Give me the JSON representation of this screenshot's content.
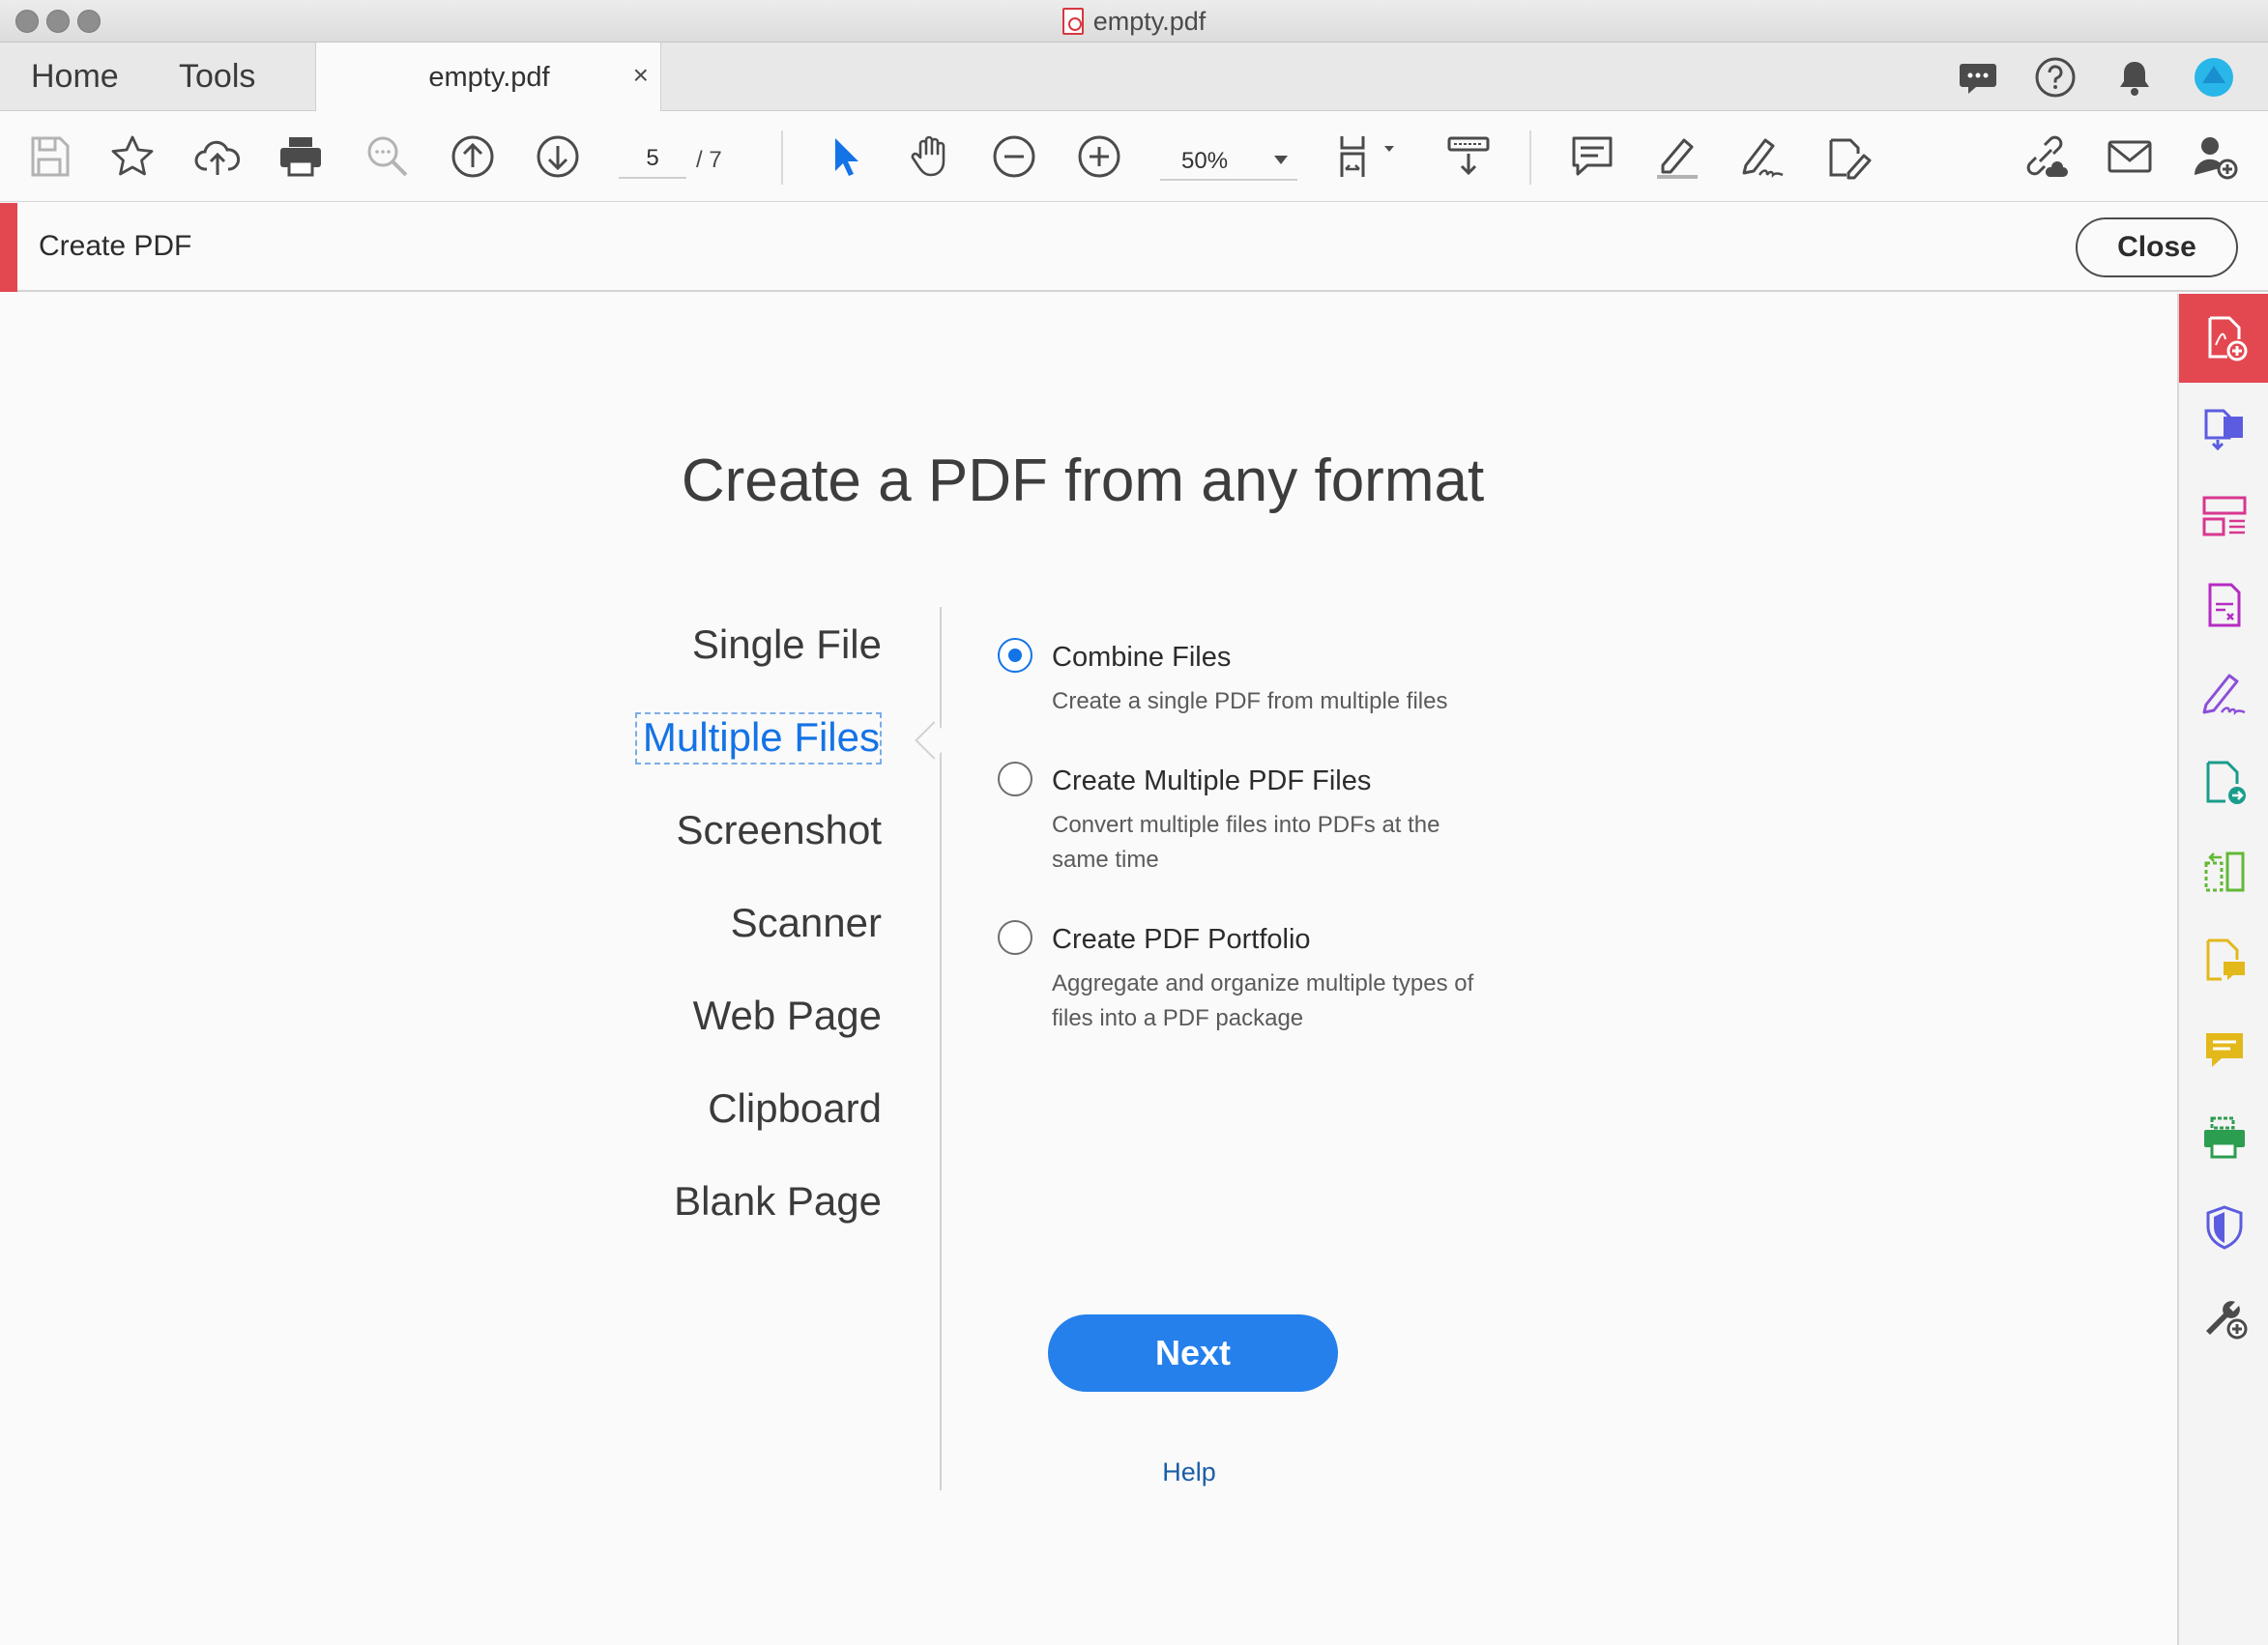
{
  "window": {
    "title": "empty.pdf"
  },
  "tabs": {
    "home": "Home",
    "tools": "Tools",
    "document": "empty.pdf",
    "close_glyph": "×"
  },
  "toolbar": {
    "current_page": "5",
    "page_total": "/ 7",
    "zoom": "50%"
  },
  "tool_header": {
    "title": "Create PDF",
    "close_label": "Close"
  },
  "main": {
    "title": "Create a PDF from any format",
    "formats": [
      {
        "label": "Single File",
        "selected": false
      },
      {
        "label": "Multiple Files",
        "selected": true
      },
      {
        "label": "Screenshot",
        "selected": false
      },
      {
        "label": "Scanner",
        "selected": false
      },
      {
        "label": "Web Page",
        "selected": false
      },
      {
        "label": "Clipboard",
        "selected": false
      },
      {
        "label": "Blank Page",
        "selected": false
      }
    ],
    "options": [
      {
        "title": "Combine Files",
        "desc": "Create a single PDF from multiple files",
        "checked": true
      },
      {
        "title": "Create Multiple PDF Files",
        "desc": "Convert multiple files into PDFs at the same time",
        "checked": false
      },
      {
        "title": "Create PDF Portfolio",
        "desc": "Aggregate and organize multiple types of files into a PDF package",
        "checked": false
      }
    ],
    "next_label": "Next",
    "help_label": "Help"
  },
  "colors": {
    "accent_blue": "#2680eb",
    "accent_red": "#e34850",
    "link": "#1b5ea8"
  },
  "icons": {
    "toolbar": [
      "save-icon",
      "star-icon",
      "cloud-upload-icon",
      "print-icon",
      "find-icon",
      "page-up-icon",
      "page-down-icon",
      "select-cursor-icon",
      "hand-icon",
      "zoom-out-icon",
      "zoom-in-icon",
      "fit-page-icon",
      "scroll-mode-icon",
      "comment-icon",
      "highlight-icon",
      "sign-icon",
      "edit-icon",
      "share-link-icon",
      "email-icon",
      "add-user-icon"
    ],
    "right_rail": [
      "create-pdf-icon",
      "export-pdf-icon",
      "organize-pages-icon",
      "edit-pdf-icon",
      "fill-sign-icon",
      "send-for-signature-icon",
      "compare-icon",
      "comment-file-icon",
      "comment-icon",
      "print-production-icon",
      "protect-icon",
      "more-tools-icon"
    ]
  }
}
